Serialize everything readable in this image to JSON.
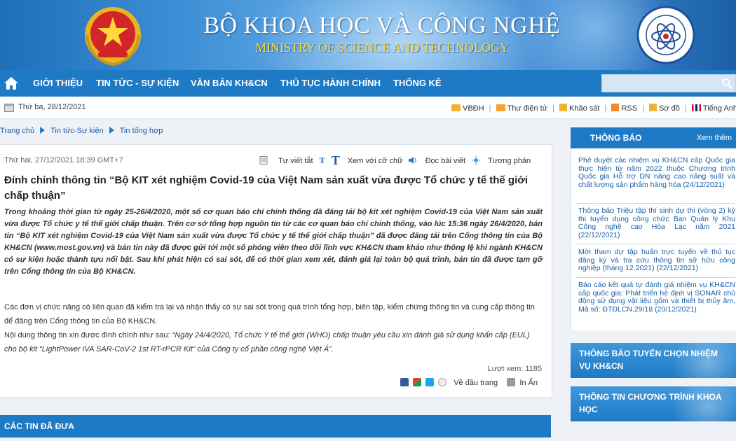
{
  "header": {
    "title_vi": "BỘ KHOA HỌC VÀ CÔNG NGHỆ",
    "title_en": "MINISTRY OF SCIENCE AND TECHNOLOGY",
    "ministry_logo_text": "Bộ Khoa học và Công nghệ"
  },
  "nav": {
    "items": [
      "GIỚI THIỆU",
      "TIN TỨC - SỰ KIỆN",
      "VĂN BẢN KH&CN",
      "THỦ TỤC HÀNH CHÍNH",
      "THỐNG KÊ"
    ],
    "search_placeholder": ""
  },
  "util": {
    "date": "Thứ ba, 28/12/2021",
    "links": [
      "VBĐH",
      "Thư điện tử",
      "Khảo sát",
      "RSS",
      "Sơ đồ",
      "Tiếng Anh"
    ]
  },
  "breadcrumb": [
    "Trang chủ",
    "Tin tức-Sự kiện",
    "Tin tổng hợp"
  ],
  "article": {
    "date": "Thứ hai, 27/12/2021 18:39 GMT+7",
    "toolbar": {
      "auto_size": "Tự viết tắt",
      "small_t": "T",
      "big_t": "T",
      "view_large": "Xem với cỡ chữ",
      "read_article": "Đọc bài viết",
      "contrast": "Tương phản"
    },
    "title": "Đính chính thông tin “Bộ KIT xét nghiệm Covid-19 của Việt Nam sản xuất vừa được Tổ chức y tế thế giới chấp thuận”",
    "lead": "Trong khoảng thời gian từ ngày 25-26/4/2020, một số cơ quan báo chí chính thống đã đăng tải bộ kit xét nghiệm Covid-19 của Việt Nam sản xuất vừa được Tổ chức y tế thế giới chấp thuận. Trên cơ sở tổng hợp nguồn tin từ các cơ quan báo chí chính thống, vào lúc 15:36 ngày 26/4/2020, bản tin “Bộ KIT xét nghiệm Covid-19 của Việt Nam sản xuất vừa được Tổ chức y tế thế giới chấp thuận” đã được đăng tải trên Cổng thông tin của Bộ KH&CN (www.most.gov.vn) và bản tin này đã được gửi tới một số phóng viên theo dõi lĩnh vực KH&CN tham khảo như thông lệ khi ngành KH&CN có sự kiện hoặc thành tựu nổi bật. Sau khi phát hiện có sai sót, để có thời gian xem xét, đánh giá lại toàn bộ quá trình, bản tin đã được tạm gỡ trên Cổng thông tin của Bộ KH&CN.",
    "para1": "Các đơn vị chức năng có liên quan đã kiểm tra lại và nhận thấy có sự sai sót trong quá trình tổng hợp, biên tập, kiểm chứng thông tin và cung cấp thông tin để đăng trên Cổng thông tin của Bộ KH&CN.",
    "para2_prefix": "Nội dung thông tin xin được đính chính như sau: ",
    "para2_quote": "“Ngày 24/4/2020, Tổ chức Y tế thế giới (WHO) chấp thuận yêu cầu xin đánh giá sử dụng khẩn cấp (EUL) cho bộ kit “LightPower iVA SAR-CoV-2 1st RT-rPCR Kit” của Công ty cổ phần công nghệ Việt Á”.",
    "views": "Lượt xem: 1185",
    "back_to_top": "Về đầu trang",
    "print": "In Ấn"
  },
  "prev_section": "CÁC TIN ĐÃ ĐƯA",
  "sidebar": {
    "notice_title": "THÔNG BÁO",
    "notice_more": "Xem thêm",
    "notices": [
      {
        "text": "Phê duyệt các nhiệm vụ KH&CN cấp Quốc gia thực hiện từ năm 2022 thuộc Chương trình Quốc gia Hỗ trợ DN nâng cao năng suất và chất lượng sản phẩm hàng hóa",
        "date": "(24/12/2021)"
      },
      {
        "text": "Thông báo Triệu tập thí sinh dự thi (vòng 2) kỳ thi tuyển dụng công chức Ban Quản lý Khu Công nghệ cao Hòa Lạc năm 2021",
        "date": "(22/12/2021)"
      },
      {
        "text": "Mời tham dự tập huấn trực tuyến về thủ tục đăng ký và tra cứu thông tin sở hữu công nghiệp (tháng 12.2021)",
        "date": "(22/12/2021)"
      },
      {
        "text": "Báo cáo kết quả tự đánh giá nhiệm vụ KH&CN cấp quốc gia: Phát triển hệ định vị SONAR chủ động sử dụng vật liệu gốm và thiết bị thủy âm, Mã số: ĐTĐLCN.29/18",
        "date": "(20/12/2021)"
      }
    ],
    "buttons": [
      "THÔNG BÁO TUYỂN CHỌN NHIỆM VỤ KH&CN",
      "THÔNG TIN CHƯƠNG TRÌNH KHOA HỌC"
    ]
  }
}
